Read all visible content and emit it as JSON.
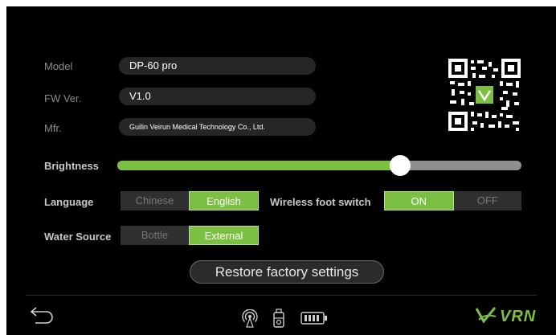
{
  "device_info": {
    "model": {
      "label": "Model",
      "value": "DP-60 pro"
    },
    "fw_version": {
      "label": "FW Ver.",
      "value": "V1.0"
    },
    "manufacturer": {
      "label": "Mfr.",
      "value": "Guilin Veirun Medical Technology Co., Ltd."
    }
  },
  "brightness": {
    "label": "Brightness",
    "level_percent": 70
  },
  "language": {
    "label": "Language",
    "options": [
      "Chinese",
      "English"
    ],
    "selected": "English"
  },
  "wireless_foot_switch": {
    "label": "Wireless foot switch",
    "options": [
      "ON",
      "OFF"
    ],
    "selected": "ON"
  },
  "water_source": {
    "label": "Water Source",
    "options": [
      "Bottle",
      "External"
    ],
    "selected": "External"
  },
  "restore_button": {
    "label": "Restore factory settings"
  },
  "footer": {
    "back_icon": "back-arrow-icon",
    "status_icons": [
      "wireless-signal-icon",
      "water-bottle-icon",
      "battery-icon"
    ],
    "logo_text": "VRN"
  },
  "colors": {
    "accent": "#7bc043",
    "background": "#000000",
    "field": "#262626"
  }
}
